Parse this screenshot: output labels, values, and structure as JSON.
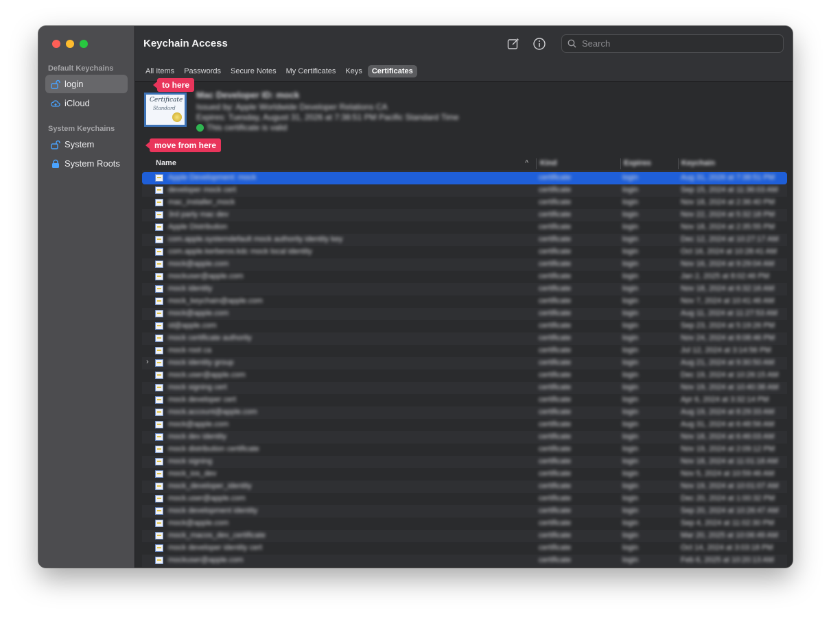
{
  "window": {
    "title": "Keychain Access",
    "search_placeholder": "Search"
  },
  "sidebar": {
    "default_header": "Default Keychains",
    "system_header": "System Keychains",
    "items": [
      {
        "label": "login"
      },
      {
        "label": "iCloud"
      },
      {
        "label": "System"
      },
      {
        "label": "System Roots"
      }
    ]
  },
  "callouts": {
    "to": "to here",
    "from": "move from here"
  },
  "tabs": [
    {
      "label": "All Items"
    },
    {
      "label": "Passwords"
    },
    {
      "label": "Secure Notes"
    },
    {
      "label": "My Certificates"
    },
    {
      "label": "Keys"
    },
    {
      "label": "Certificates"
    }
  ],
  "info": {
    "line1": "Mac Developer ID: mock",
    "line2": "Issued by: Apple Worldwide Developer Relations CA",
    "line3": "Expires: Tuesday, August 31, 2026 at 7:38:51 PM Pacific Standard Time",
    "line4": "This certificate is valid"
  },
  "table": {
    "headers": {
      "name": "Name",
      "kind": "Kind",
      "expires": "Expires",
      "keychain": "Keychain"
    },
    "rows": [
      {
        "name": "Apple Development: mock",
        "kind": "certificate",
        "exp": "login",
        "keychain": "Aug 31, 2026 at 7:38:51 PM"
      },
      {
        "name": "developer mock cert",
        "kind": "certificate",
        "exp": "login",
        "keychain": "Sep 15, 2024 at 11:36:03 AM"
      },
      {
        "name": "mac_installer_mock",
        "kind": "certificate",
        "exp": "login",
        "keychain": "Nov 18, 2024 at 2:36:40 PM"
      },
      {
        "name": "3rd party mac dev",
        "kind": "certificate",
        "exp": "login",
        "keychain": "Nov 22, 2024 at 5:32:18 PM"
      },
      {
        "name": "Apple Distribution",
        "kind": "certificate",
        "exp": "login",
        "keychain": "Nov 18, 2024 at 2:35:55 PM"
      },
      {
        "name": "com.apple.systemdefault mock authority identity key",
        "kind": "certificate",
        "exp": "login",
        "keychain": "Dec 12, 2024 at 10:27:17 AM"
      },
      {
        "name": "com.apple.kerberos.kdc mock local identity",
        "kind": "certificate",
        "exp": "login",
        "keychain": "Oct 16, 2024 at 10:28:41 AM"
      },
      {
        "name": "mock@apple.com",
        "kind": "certificate",
        "exp": "login",
        "keychain": "Nov 16, 2024 at 9:29:04 AM"
      },
      {
        "name": "mockuser@apple.com",
        "kind": "certificate",
        "exp": "login",
        "keychain": "Jan 2, 2025 at 8:02:46 PM"
      },
      {
        "name": "mock identity",
        "kind": "certificate",
        "exp": "login",
        "keychain": "Nov 18, 2024 at 6:32:16 AM"
      },
      {
        "name": "mock_keychain@apple.com",
        "kind": "certificate",
        "exp": "login",
        "keychain": "Nov 7, 2024 at 10:41:46 AM"
      },
      {
        "name": "mock@apple.com",
        "kind": "certificate",
        "exp": "login",
        "keychain": "Aug 11, 2024 at 11:27:53 AM"
      },
      {
        "name": "id@apple.com",
        "kind": "certificate",
        "exp": "login",
        "keychain": "Sep 23, 2024 at 5:19:26 PM"
      },
      {
        "name": "mock certificate authority",
        "kind": "certificate",
        "exp": "login",
        "keychain": "Nov 24, 2024 at 8:08:46 PM"
      },
      {
        "name": "mock root ca",
        "kind": "certificate",
        "exp": "login",
        "keychain": "Jul 12, 2024 at 3:14:56 PM"
      },
      {
        "name": "mock identity group",
        "kind": "certificate",
        "exp": "login",
        "keychain": "Aug 21, 2024 at 9:30:50 AM",
        "expandable": true
      },
      {
        "name": "mock.user@apple.com",
        "kind": "certificate",
        "exp": "login",
        "keychain": "Dec 19, 2024 at 10:26:15 AM"
      },
      {
        "name": "mock signing cert",
        "kind": "certificate",
        "exp": "login",
        "keychain": "Nov 19, 2024 at 10:40:38 AM"
      },
      {
        "name": "mock developer cert",
        "kind": "certificate",
        "exp": "login",
        "keychain": "Apr 6, 2024 at 3:32:14 PM"
      },
      {
        "name": "mock.account@apple.com",
        "kind": "certificate",
        "exp": "login",
        "keychain": "Aug 19, 2024 at 8:29:33 AM"
      },
      {
        "name": "mock@apple.com",
        "kind": "certificate",
        "exp": "login",
        "keychain": "Aug 31, 2024 at 6:48:56 AM"
      },
      {
        "name": "mock dev identity",
        "kind": "certificate",
        "exp": "login",
        "keychain": "Nov 18, 2024 at 6:46:03 AM"
      },
      {
        "name": "mock distribution certificate",
        "kind": "certificate",
        "exp": "login",
        "keychain": "Nov 19, 2024 at 2:09:12 PM"
      },
      {
        "name": "mock signing",
        "kind": "certificate",
        "exp": "login",
        "keychain": "Nov 18, 2024 at 11:01:18 AM"
      },
      {
        "name": "mock_ios_dev",
        "kind": "certificate",
        "exp": "login",
        "keychain": "Nov 5, 2024 at 10:59:46 AM"
      },
      {
        "name": "mock_developer_identity",
        "kind": "certificate",
        "exp": "login",
        "keychain": "Nov 19, 2024 at 10:01:07 AM"
      },
      {
        "name": "mock.user@apple.com",
        "kind": "certificate",
        "exp": "login",
        "keychain": "Dec 20, 2024 at 1:00:32 PM"
      },
      {
        "name": "mock development identity",
        "kind": "certificate",
        "exp": "login",
        "keychain": "Sep 20, 2024 at 10:26:47 AM"
      },
      {
        "name": "mock@apple.com",
        "kind": "certificate",
        "exp": "login",
        "keychain": "Sep 4, 2024 at 11:02:30 PM"
      },
      {
        "name": "mock_macos_dev_certificate",
        "kind": "certificate",
        "exp": "login",
        "keychain": "Mar 20, 2025 at 10:06:49 AM"
      },
      {
        "name": "mock developer identity cert",
        "kind": "certificate",
        "exp": "login",
        "keychain": "Oct 14, 2024 at 3:03:18 PM"
      },
      {
        "name": "mockuser@apple.com",
        "kind": "certificate",
        "exp": "login",
        "keychain": "Feb 6, 2025 at 10:20:13 AM"
      }
    ]
  }
}
